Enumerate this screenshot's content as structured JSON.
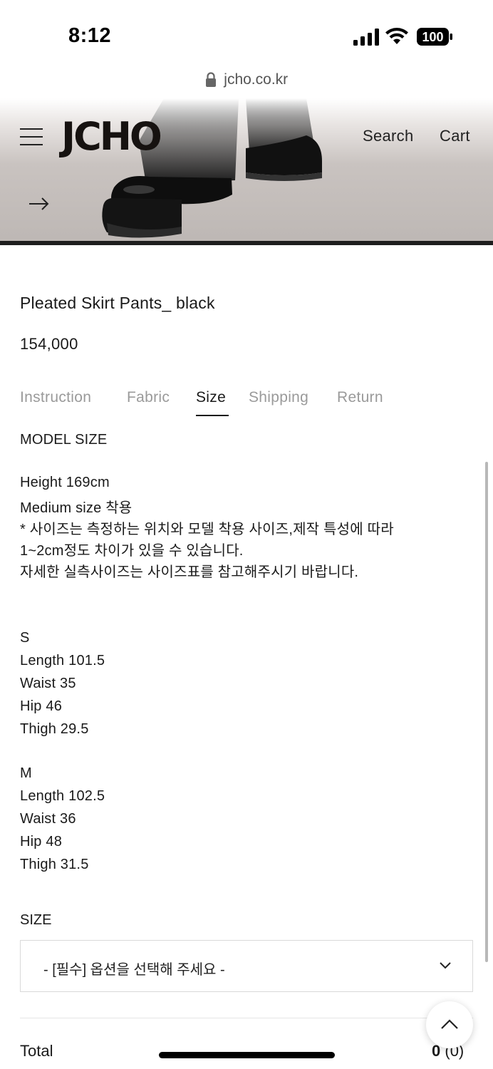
{
  "status_bar": {
    "time": "8:12",
    "battery": "100"
  },
  "browser": {
    "url": "jcho.co.kr"
  },
  "header": {
    "logo": "JCHO",
    "nav": {
      "search": "Search",
      "cart": "Cart"
    }
  },
  "product": {
    "name": "Pleated Skirt Pants_ black",
    "price": "154,000"
  },
  "tabs": [
    {
      "label": "Instruction",
      "active": false
    },
    {
      "label": "Fabric",
      "active": false
    },
    {
      "label": "Size",
      "active": true
    },
    {
      "label": "Shipping",
      "active": false
    },
    {
      "label": "Return",
      "active": false
    }
  ],
  "size_info": {
    "model_heading": "MODEL SIZE",
    "model_lines": [
      "Height 169cm",
      "Medium size 착용",
      "* 사이즈는 측정하는 위치와 모델 착용 사이즈,제작 특성에 따라",
      "1~2cm정도 차이가 있을 수 있습니다.",
      "자세한 실측사이즈는 사이즈표를 참고해주시기 바랍니다."
    ],
    "sizes": [
      {
        "name": "S",
        "length": "Length 101.5",
        "waist": "Waist 35",
        "hip": "Hip 46",
        "thigh": "Thigh 29.5"
      },
      {
        "name": "M",
        "length": "Length 102.5",
        "waist": "Waist 36",
        "hip": "Hip 48",
        "thigh": "Thigh 31.5"
      }
    ]
  },
  "option": {
    "label": "SIZE",
    "placeholder": "- [필수] 옵션을 선택해 주세요 -"
  },
  "total": {
    "label": "Total",
    "amount": "0",
    "count": "(0)"
  },
  "icons": {
    "menu": "hamburger-icon",
    "lock": "lock-icon",
    "arrow": "arrow-right-icon",
    "chevron": "chevron-down-icon",
    "top": "chevron-up-icon"
  }
}
